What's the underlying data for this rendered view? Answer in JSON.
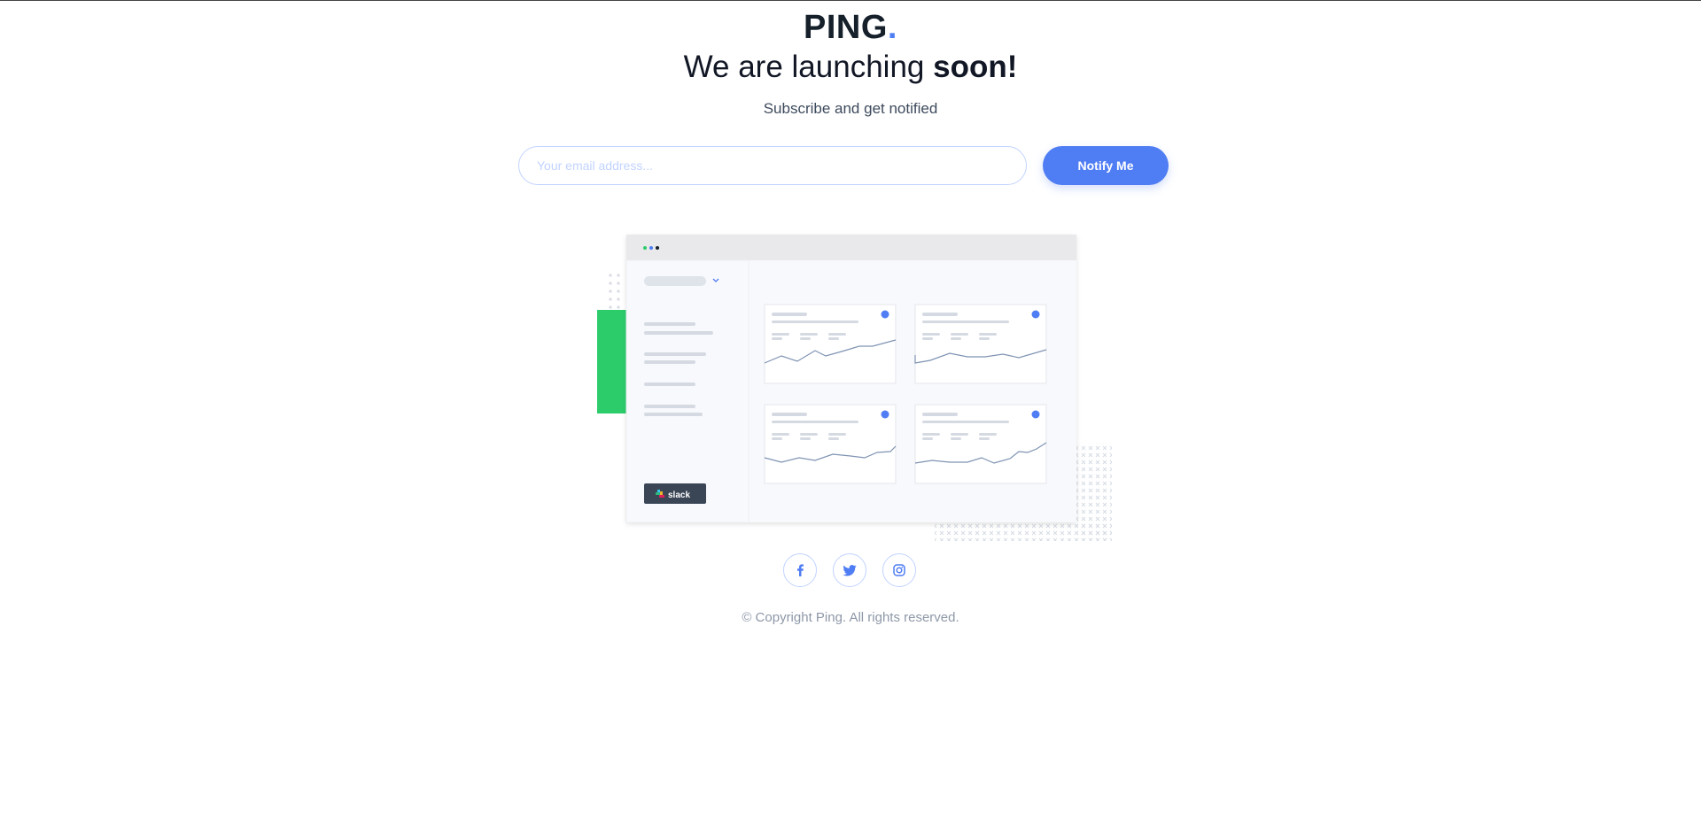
{
  "brand": {
    "name": "PING",
    "dot": "."
  },
  "hero": {
    "headline_start": "We are launching ",
    "headline_emphasis": "soon!",
    "subtitle": "Subscribe and get notified"
  },
  "form": {
    "email_placeholder": "Your email address...",
    "email_value": "",
    "button_label": "Notify Me"
  },
  "dashboard": {
    "integration_label": "slack"
  },
  "social": [
    {
      "name": "facebook-icon"
    },
    {
      "name": "twitter-icon"
    },
    {
      "name": "instagram-icon"
    }
  ],
  "footer": {
    "copyright": "© Copyright Ping. All rights reserved."
  },
  "colors": {
    "accent": "#4f7df3",
    "border": "#c2d3ff",
    "dark": "#15202b",
    "green": "#2ccc6b"
  }
}
